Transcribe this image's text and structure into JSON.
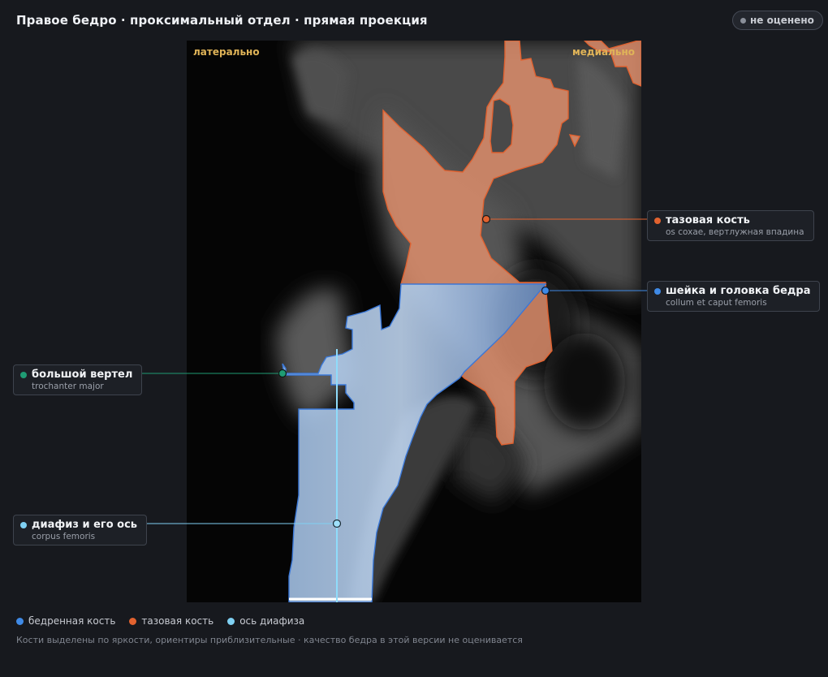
{
  "header": {
    "title": "Правое бедро · проксимальный отдел · прямая проекция",
    "status_label": "не оценено"
  },
  "viewer": {
    "left_label": "латерально",
    "right_label": "медиально"
  },
  "landmarks": [
    {
      "id": "pelvis",
      "name": "тазовая кость",
      "latin": "os coxae, вертлужная впадина",
      "color": "#e2622f"
    },
    {
      "id": "neck",
      "name": "шейка и головка бедра",
      "latin": "collum et caput femoris",
      "color": "#3f8ae6"
    },
    {
      "id": "trochanter",
      "name": "большой вертел",
      "latin": "trochanter major",
      "color": "#1f9c74"
    },
    {
      "id": "shaft",
      "name": "диафиз и его ось",
      "latin": "corpus femoris",
      "color": "#7fd0f2"
    }
  ],
  "legend": [
    {
      "label": "бедренная кость",
      "color": "#3f8ae6"
    },
    {
      "label": "тазовая кость",
      "color": "#e2622f"
    },
    {
      "label": "ось диафиза",
      "color": "#7fd0f2"
    }
  ],
  "footer": "Кости выделены по яркости, ориентиры приблизительные · качество бедра в этой версии не оценивается"
}
